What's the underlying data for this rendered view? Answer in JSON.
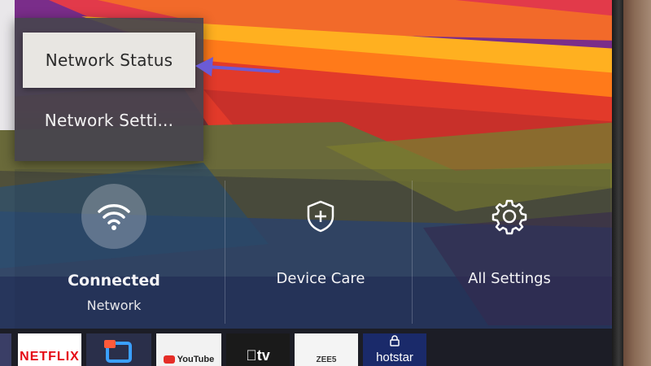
{
  "popup_menu": {
    "items": [
      {
        "label": "Network Status"
      },
      {
        "label": "Network Setti..."
      }
    ]
  },
  "quick_settings": {
    "network": {
      "title": "Connected",
      "subtitle": "Network",
      "icon": "wifi-icon"
    },
    "device_care": {
      "title": "Device Care",
      "icon": "shield-plus-icon"
    },
    "all_settings": {
      "title": "All Settings",
      "icon": "gear-icon"
    }
  },
  "apps": [
    {
      "label": "NETFLIX"
    },
    {
      "label": ""
    },
    {
      "label": "YouTube"
    },
    {
      "label": "tv"
    },
    {
      "label": "ZEE5"
    },
    {
      "label": "hotstar"
    }
  ],
  "colors": {
    "accent_arrow": "#6b5bd6",
    "netflix_red": "#e50914"
  }
}
